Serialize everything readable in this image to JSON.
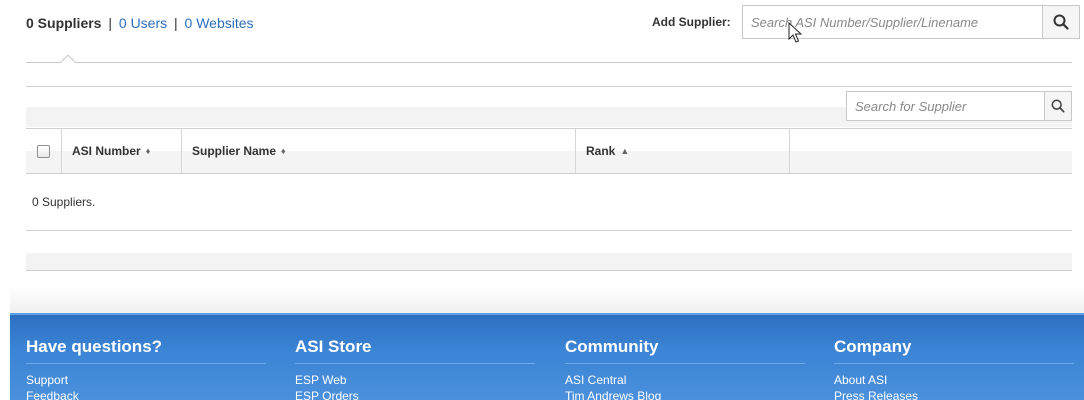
{
  "tabs": {
    "active": "0 Suppliers",
    "separator": "|",
    "users": "0 Users",
    "websites": "0 Websites"
  },
  "add_supplier": {
    "label": "Add Supplier:",
    "placeholder": "Search ASI Number/Supplier/Linename",
    "icon": "search-icon"
  },
  "supplier_search": {
    "placeholder": "Search for Supplier",
    "icon": "search-icon"
  },
  "table": {
    "columns": [
      {
        "label": "ASI Number",
        "sort": "both"
      },
      {
        "label": "Supplier Name",
        "sort": "both"
      },
      {
        "label": "Rank",
        "sort": "asc"
      }
    ],
    "empty_message": "0 Suppliers."
  },
  "footer": {
    "columns": [
      {
        "title": "Have questions?",
        "links": [
          "Support",
          "Feedback"
        ]
      },
      {
        "title": "ASI Store",
        "links": [
          "ESP Web",
          "ESP Orders"
        ]
      },
      {
        "title": "Community",
        "links": [
          "ASI Central",
          "Tim Andrews Blog"
        ]
      },
      {
        "title": "Company",
        "links": [
          "About ASI",
          "Press Releases"
        ]
      }
    ]
  },
  "colors": {
    "link": "#2a6ebb",
    "footer_bg": "#3b83d4",
    "text": "#333333"
  }
}
